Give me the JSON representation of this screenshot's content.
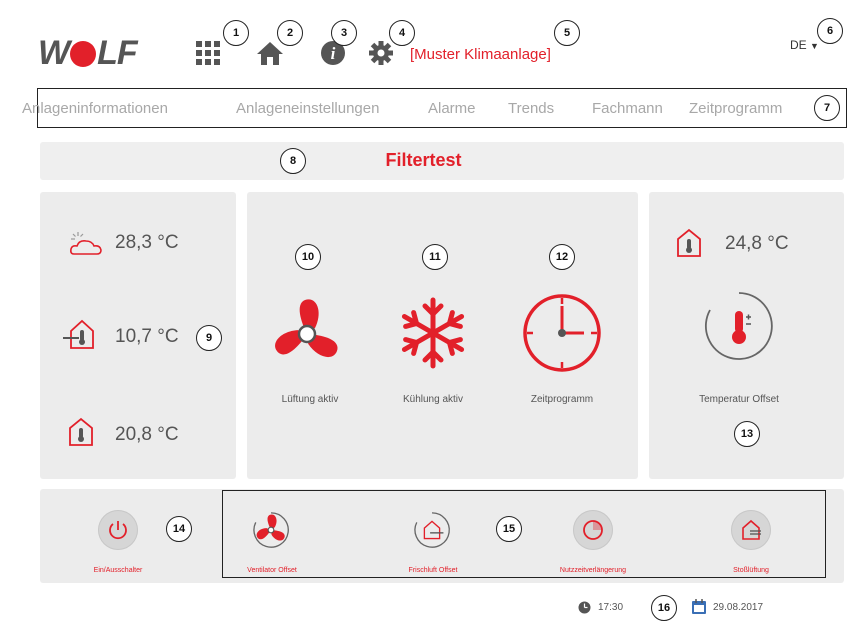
{
  "header": {
    "logo_text": "WOLF",
    "title": "[Muster Klimaanlage]",
    "language": "DE",
    "icons": [
      "apps-grid-icon",
      "home-icon",
      "info-icon",
      "gear-icon"
    ]
  },
  "nav": {
    "items": [
      {
        "label": "Anlageninformationen"
      },
      {
        "label": "Anlageneinstellungen"
      },
      {
        "label": "Alarme"
      },
      {
        "label": "Trends"
      },
      {
        "label": "Fachmann"
      },
      {
        "label": "Zeitprogramm"
      }
    ]
  },
  "page": {
    "title": "Filtertest"
  },
  "left_panel": {
    "outdoor_temp": "28,3 °C",
    "fresh_air_temp": "10,7 °C",
    "room_temp": "20,8 °C"
  },
  "center_panel": {
    "fan_label": "Lüftung aktiv",
    "cooling_label": "Kühlung aktiv",
    "schedule_label": "Zeitprogramm"
  },
  "right_panel": {
    "room_temp": "24,8 °C",
    "offset_label": "Temperatur Offset"
  },
  "bottom": {
    "power_label": "Ein/Ausschalter",
    "fan_offset_label": "Ventilator Offset",
    "fresh_air_offset_label": "Frischluft Offset",
    "usage_extension_label": "Nutzzeitverlängerung",
    "boost_ventilation_label": "Stoßlüftung"
  },
  "footer": {
    "time": "17:30",
    "date": "29.08.2017"
  },
  "callouts": [
    "1",
    "2",
    "3",
    "4",
    "5",
    "6",
    "7",
    "8",
    "9",
    "10",
    "11",
    "12",
    "13",
    "14",
    "15",
    "16"
  ],
  "colors": {
    "accent": "#e2202a",
    "panel_bg": "#ececec",
    "text": "#555555"
  }
}
